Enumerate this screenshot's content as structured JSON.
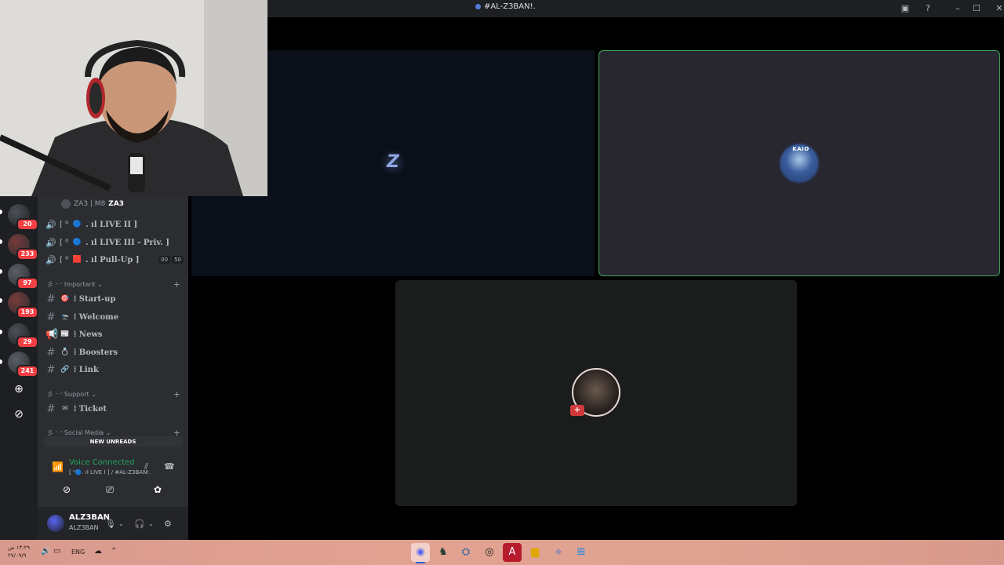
{
  "window": {
    "title": "#AL-Z3BAN!.",
    "controls": [
      "inbox-icon",
      "help-icon",
      "minimize-icon",
      "maximize-icon",
      "close-icon"
    ]
  },
  "server_rail": {
    "badges": [
      "20",
      "233",
      "97",
      "193",
      "29",
      "241"
    ],
    "add_server_icon": "plus-icon",
    "explore_icon": "compass-icon"
  },
  "sidebar": {
    "voice_user": {
      "name": "ZA3 | M8",
      "tag": "ZA3"
    },
    "voice_channels": [
      {
        "prefix": "[ ⁰ ",
        "label": ". ıl LIVE II ]",
        "emoji": "🔵"
      },
      {
        "prefix": "[ ⁰ ",
        "label": ". ıl LIVE III - Priv. ]",
        "emoji": "🔵"
      },
      {
        "prefix": "[ ⁰ ",
        "label": ". ıl Pull-Up ]",
        "emoji": "🟥",
        "counts": [
          "00",
          "50"
        ]
      }
    ],
    "categories": [
      {
        "label": "彡 ⁻ ʳ Important ⌄",
        "channels": [
          {
            "emoji": "🎯",
            "label": "⁞ Start-up"
          },
          {
            "emoji": "🛬",
            "label": "⁞ Welcome"
          },
          {
            "emoji": "📰",
            "label": "⁞ News"
          },
          {
            "emoji": "💍",
            "label": "⁞ Boosters"
          },
          {
            "emoji": "🔗",
            "label": "⁞ Link"
          }
        ]
      },
      {
        "label": "彡 ⁻ ʳ Support ⌄",
        "channels": [
          {
            "emoji": "✉",
            "label": "⁞ Ticket"
          }
        ]
      },
      {
        "label": "彡 ⁻ ʳ Social Media ⌄",
        "channels": []
      }
    ],
    "new_unreads": "NEW UNREADS"
  },
  "voice_panel": {
    "status": "Voice Connected",
    "channel": "[ ⁰🔵. ıl LIVE I ] / #AL-Z3BAN!."
  },
  "user_panel": {
    "name": "ALZ3BAN",
    "status": "ALZ3BAN"
  },
  "tiles": {
    "tile2_label": "KAIO"
  },
  "taskbar": {
    "time": "١٣:٢٩ ص",
    "date": "٢٧/٠٩/٩",
    "lang": "ENG"
  }
}
